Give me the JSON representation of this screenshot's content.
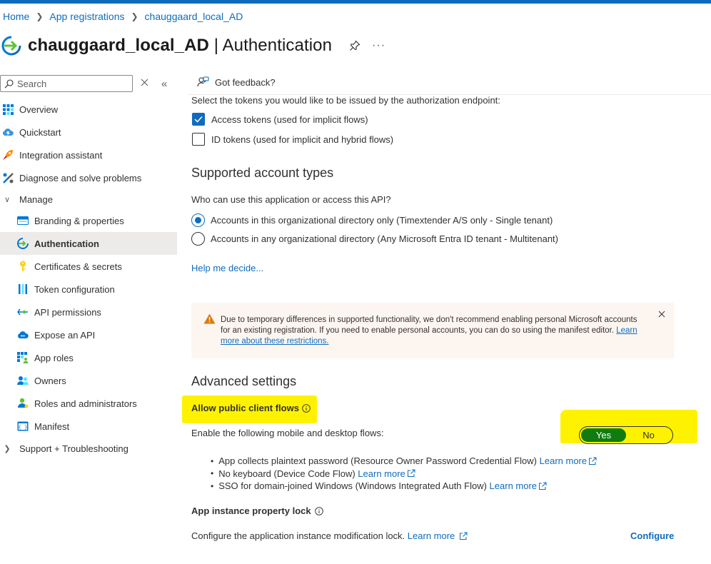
{
  "breadcrumb": {
    "home": "Home",
    "app_registrations": "App registrations",
    "current": "chauggaard_local_AD"
  },
  "header": {
    "app_name": "chauggaard_local_AD",
    "separator": " | ",
    "page": "Authentication",
    "more": "···"
  },
  "sidebar": {
    "search_placeholder": "Search",
    "items": [
      {
        "label": "Overview",
        "icon": "grid-icon"
      },
      {
        "label": "Quickstart",
        "icon": "cloud-icon"
      },
      {
        "label": "Integration assistant",
        "icon": "rocket-icon"
      },
      {
        "label": "Diagnose and solve problems",
        "icon": "wrench-icon"
      },
      {
        "label": "Manage",
        "icon": "chevron-down-icon"
      },
      {
        "label": "Branding & properties",
        "icon": "card-icon"
      },
      {
        "label": "Authentication",
        "icon": "authentication-icon"
      },
      {
        "label": "Certificates & secrets",
        "icon": "key-icon"
      },
      {
        "label": "Token configuration",
        "icon": "bars-icon"
      },
      {
        "label": "API permissions",
        "icon": "api-icon"
      },
      {
        "label": "Expose an API",
        "icon": "cloud-api-icon"
      },
      {
        "label": "App roles",
        "icon": "app-roles-icon"
      },
      {
        "label": "Owners",
        "icon": "people-icon"
      },
      {
        "label": "Roles and administrators",
        "icon": "person-icon"
      },
      {
        "label": "Manifest",
        "icon": "manifest-icon"
      },
      {
        "label": "Support + Troubleshooting",
        "icon": "chevron-right-icon"
      }
    ]
  },
  "main": {
    "feedback": "Got feedback?",
    "tokens_prompt": "Select the tokens you would like to be issued by the authorization endpoint:",
    "access_tokens": {
      "label": "Access tokens (used for implicit flows)",
      "checked": true
    },
    "id_tokens": {
      "label": "ID tokens (used for implicit and hybrid flows)",
      "checked": false
    },
    "account_types_title": "Supported account types",
    "account_types_question": "Who can use this application or access this API?",
    "account_options": [
      {
        "label": "Accounts in this organizational directory only (Timextender A/S only - Single tenant)",
        "selected": true
      },
      {
        "label": "Accounts in any organizational directory (Any Microsoft Entra ID tenant - Multitenant)",
        "selected": false
      }
    ],
    "help_link": "Help me decide...",
    "warning": {
      "text": "Due to temporary differences in supported functionality, we don't recommend enabling personal Microsoft accounts for an existing registration. If you need to enable personal accounts, you can do so using the manifest editor.",
      "link": "Learn more about these restrictions."
    },
    "advanced_title": "Advanced settings",
    "public_flows_title": "Allow public client flows",
    "public_flows_desc": "Enable the following mobile and desktop flows:",
    "toggle": {
      "yes": "Yes",
      "no": "No",
      "selected": "Yes"
    },
    "flows": [
      {
        "text": "App collects plaintext password (Resource Owner Password Credential Flow)",
        "link": "Learn more"
      },
      {
        "text": "No keyboard (Device Code Flow)",
        "link": "Learn more"
      },
      {
        "text": "SSO for domain-joined Windows (Windows Integrated Auth Flow)",
        "link": "Learn more"
      }
    ],
    "lock_title": "App instance property lock",
    "lock_desc": "Configure the application instance modification lock.",
    "lock_link": "Learn more",
    "configure": "Configure"
  },
  "colors": {
    "accent": "#0f6cbd",
    "toggle_on": "#107c10",
    "highlight": "#fff200",
    "warning_bg": "#fdf6f0",
    "warning_icon": "#da7b11"
  }
}
